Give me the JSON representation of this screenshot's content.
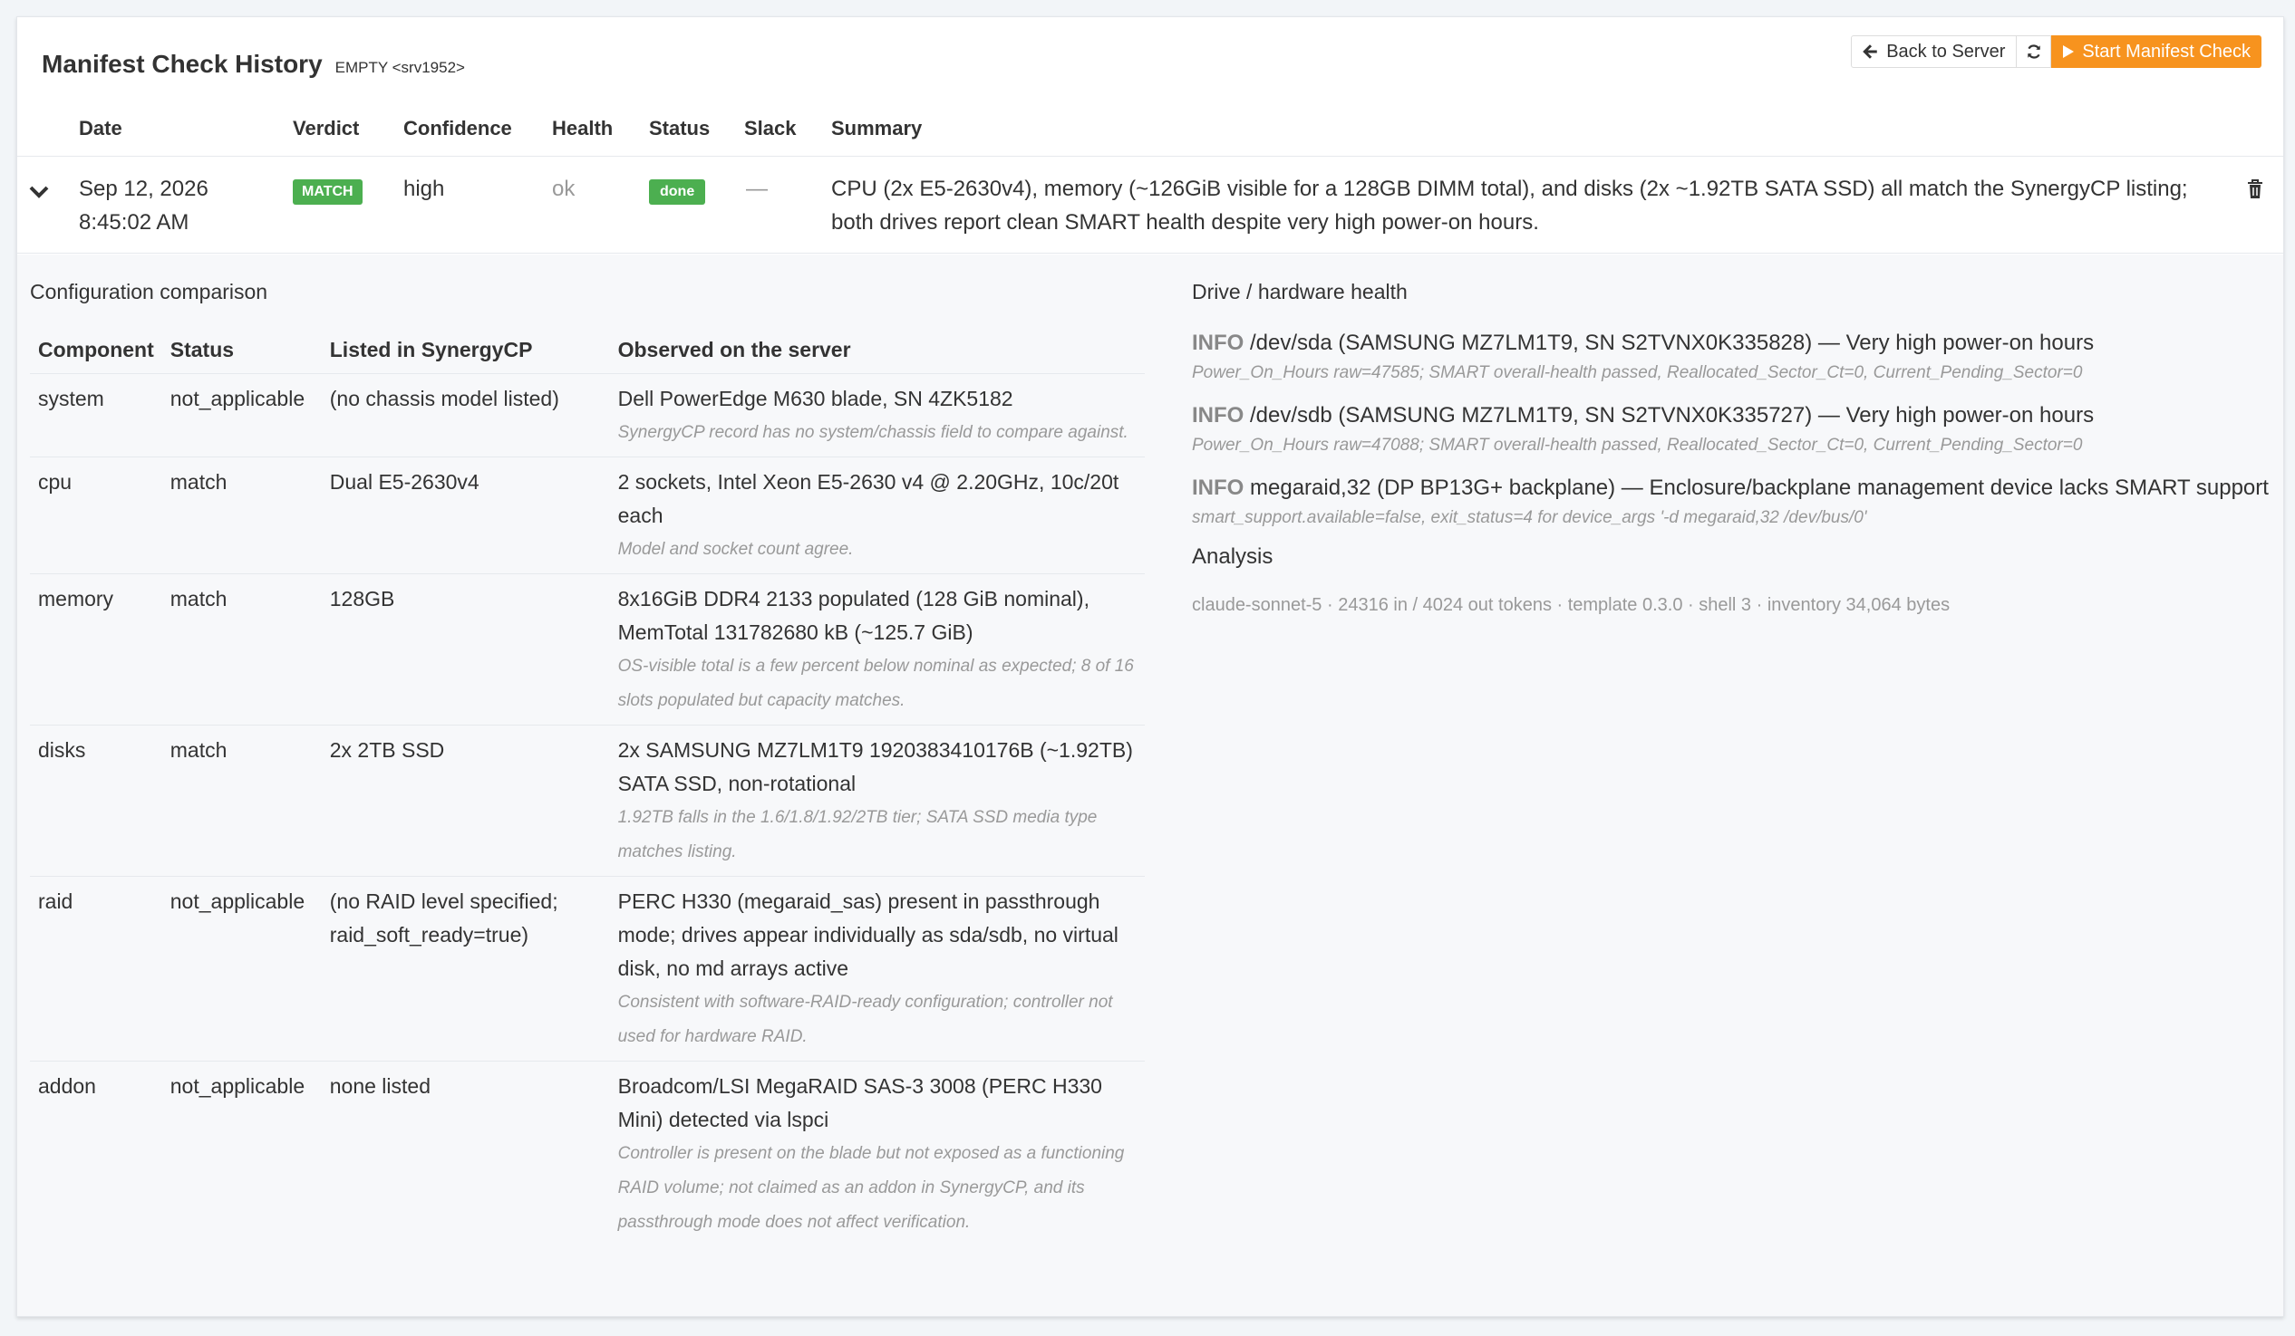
{
  "header": {
    "title": "Manifest Check History",
    "subtitle": "EMPTY <srv1952>"
  },
  "actions": {
    "back_label": "Back to Server",
    "start_label": "Start Manifest Check"
  },
  "history": {
    "columns": [
      "Date",
      "Verdict",
      "Confidence",
      "Health",
      "Status",
      "Slack",
      "Summary"
    ],
    "rows": [
      {
        "date_line1": "Sep 12, 2026",
        "date_line2": "8:45:02 AM",
        "verdict": "MATCH",
        "confidence": "high",
        "health": "ok",
        "status": "done",
        "slack": "—",
        "summary_line1": "CPU (2x E5-2630v4), memory (~126GiB visible for a 128GB DIMM total), and disks (2x ~1.92TB SATA SSD) all match the SynergyCP listing;",
        "summary_line2": "both drives report clean SMART health despite very high power-on hours."
      }
    ]
  },
  "comparison": {
    "title": "Configuration comparison",
    "columns": [
      "Component",
      "Status",
      "Listed in SynergyCP",
      "Observed on the server"
    ],
    "rows": [
      {
        "component": "system",
        "status": "not_applicable",
        "listed": "(no chassis model listed)",
        "observed": "Dell PowerEdge M630 blade, SN 4ZK5182",
        "note": "SynergyCP record has no system/chassis field to compare against."
      },
      {
        "component": "cpu",
        "status": "match",
        "listed": "Dual E5-2630v4",
        "observed": "2 sockets, Intel Xeon E5-2630 v4 @ 2.20GHz, 10c/20t each",
        "note": "Model and socket count agree."
      },
      {
        "component": "memory",
        "status": "match",
        "listed": "128GB",
        "observed": "8x16GiB DDR4 2133 populated (128 GiB nominal), MemTotal 131782680 kB (~125.7 GiB)",
        "note": "OS-visible total is a few percent below nominal as expected; 8 of 16 slots populated but capacity matches."
      },
      {
        "component": "disks",
        "status": "match",
        "listed": "2x 2TB SSD",
        "observed": "2x SAMSUNG MZ7LM1T9 1920383410176B (~1.92TB) SATA SSD, non-rotational",
        "note": "1.92TB falls in the 1.6/1.8/1.92/2TB tier; SATA SSD media type matches listing."
      },
      {
        "component": "raid",
        "status": "not_applicable",
        "listed": "(no RAID level specified; raid_soft_ready=true)",
        "observed": "PERC H330 (megaraid_sas) present in passthrough mode; drives appear individually as sda/sdb, no virtual disk, no md arrays active",
        "note": "Consistent with software-RAID-ready configuration; controller not used for hardware RAID."
      },
      {
        "component": "addon",
        "status": "not_applicable",
        "listed": "none listed",
        "observed": "Broadcom/LSI MegaRAID SAS-3 3008 (PERC H330 Mini) detected via lspci",
        "note": "Controller is present on the blade but not exposed as a functioning RAID volume; not claimed as an addon in SynergyCP, and its passthrough mode does not affect verification."
      }
    ]
  },
  "health": {
    "title": "Drive / hardware health",
    "items": [
      {
        "level": "INFO",
        "text": "/dev/sda (SAMSUNG MZ7LM1T9, SN S2TVNX0K335828) — Very high power-on hours",
        "detail": "Power_On_Hours raw=47585; SMART overall-health passed, Reallocated_Sector_Ct=0, Current_Pending_Sector=0"
      },
      {
        "level": "INFO",
        "text": "/dev/sdb (SAMSUNG MZ7LM1T9, SN S2TVNX0K335727) — Very high power-on hours",
        "detail": "Power_On_Hours raw=47088; SMART overall-health passed, Reallocated_Sector_Ct=0, Current_Pending_Sector=0"
      },
      {
        "level": "INFO",
        "text": "megaraid,32 (DP BP13G+ backplane) — Enclosure/backplane management device lacks SMART support",
        "detail": "smart_support.available=false, exit_status=4 for device_args '-d megaraid,32 /dev/bus/0'"
      }
    ],
    "analysis_title": "Analysis",
    "footer": "claude-sonnet-5 · 24316 in / 4024 out tokens · template 0.3.0 · shell 3 · inventory 34,064 bytes"
  },
  "colors": {
    "accent": "#f7931e",
    "match": "#4caf50",
    "muted": "#999999"
  }
}
